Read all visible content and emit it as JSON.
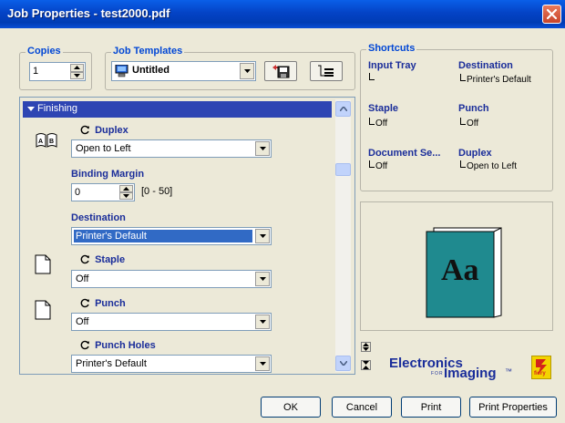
{
  "window": {
    "title": "Job Properties - test2000.pdf"
  },
  "copies": {
    "label": "Copies",
    "value": "1"
  },
  "job_templates": {
    "label": "Job Templates",
    "value": "Untitled"
  },
  "finishing": {
    "section_label": "Finishing",
    "duplex": {
      "label": "Duplex",
      "value": "Open to Left"
    },
    "binding_margin": {
      "label": "Binding Margin",
      "value": "0",
      "range": "[0 - 50]"
    },
    "destination": {
      "label": "Destination",
      "value": "Printer's Default"
    },
    "staple": {
      "label": "Staple",
      "value": "Off"
    },
    "punch": {
      "label": "Punch",
      "value": "Off"
    },
    "punch_holes": {
      "label": "Punch Holes",
      "value": "Printer's Default"
    }
  },
  "shortcuts": {
    "label": "Shortcuts",
    "items": [
      {
        "title": "Input Tray",
        "value": ""
      },
      {
        "title": "Destination",
        "value": "Printer's Default"
      },
      {
        "title": "Staple",
        "value": "Off"
      },
      {
        "title": "Punch",
        "value": "Off"
      },
      {
        "title": "Document Se...",
        "value": "Off"
      },
      {
        "title": "Duplex",
        "value": "Open to Left"
      }
    ]
  },
  "preview": {
    "glyph": "Aa"
  },
  "brand": {
    "line1": "Electronics",
    "line2": "Imaging",
    "small": "FOR",
    "tm": "™",
    "logo": "fiery"
  },
  "buttons": {
    "ok": "OK",
    "cancel": "Cancel",
    "print": "Print",
    "print_properties": "Print Properties"
  },
  "colors": {
    "accent": "#0046D5",
    "section_bar": "#2E45B3",
    "label": "#1A2D9A",
    "selected": "#316AC5",
    "preview_page": "#1F8A8F"
  }
}
